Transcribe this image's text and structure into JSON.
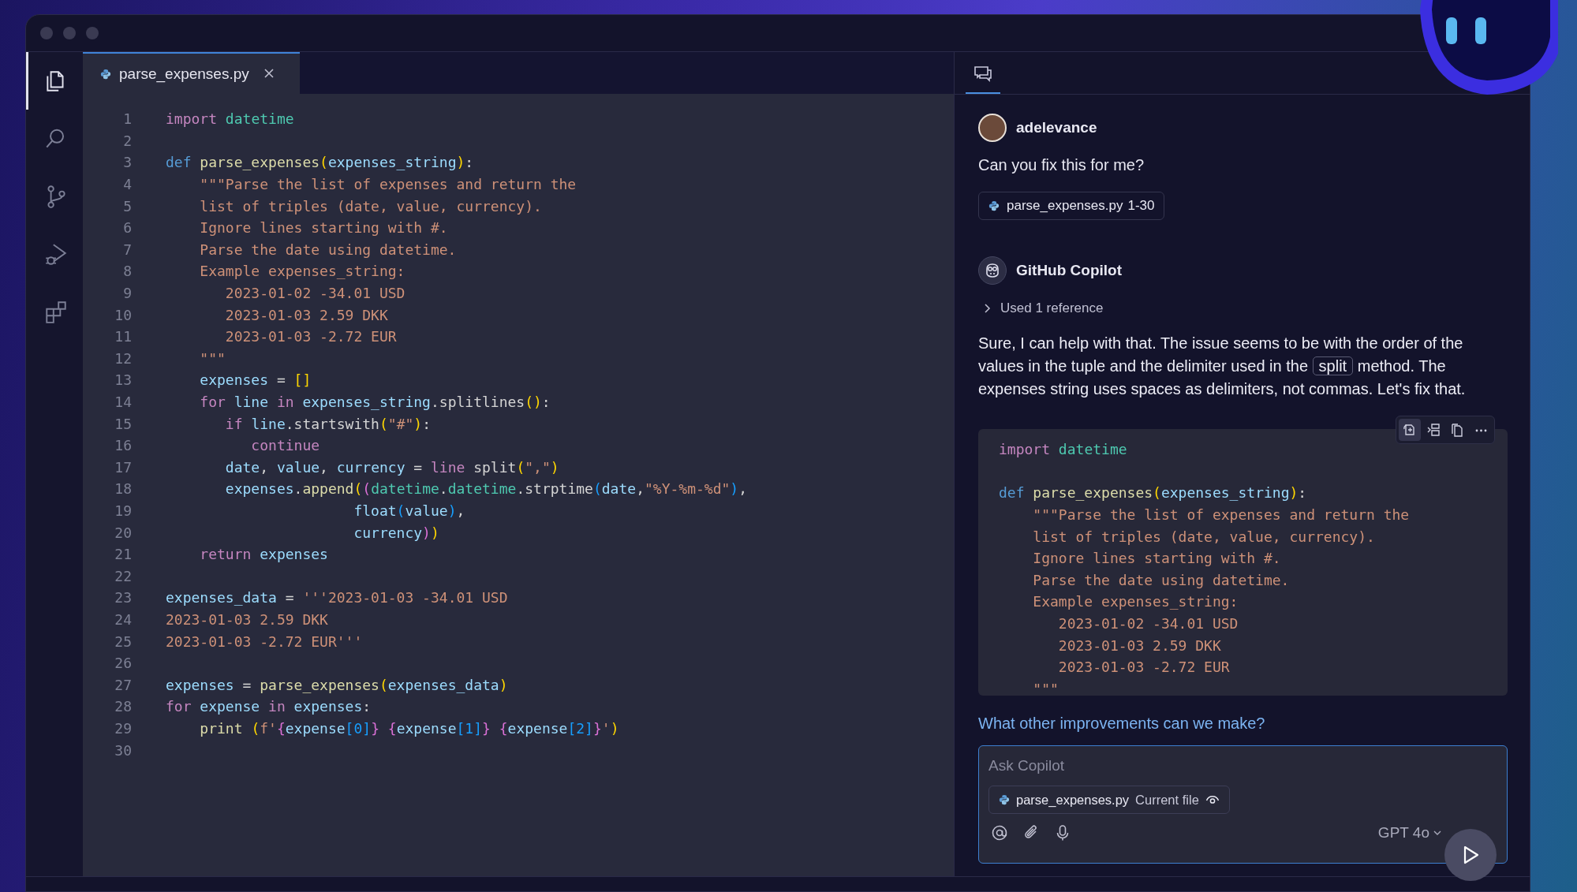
{
  "activity_bar": {
    "items": [
      {
        "kind": "files",
        "selected": true
      },
      {
        "kind": "search",
        "selected": false
      },
      {
        "kind": "source-control",
        "selected": false
      },
      {
        "kind": "run-debug",
        "selected": false
      },
      {
        "kind": "extensions",
        "selected": false
      }
    ]
  },
  "editor": {
    "tab": {
      "label": "parse_expenses.py",
      "selected": true
    },
    "lines": [
      {
        "number": "1",
        "tokens": [
          {
            "text": "import",
            "kind": "kw"
          },
          {
            "text": " datetime",
            "kind": "mod"
          }
        ]
      },
      {
        "number": "2"
      },
      {
        "number": "3",
        "tokens": [
          {
            "text": "def",
            "kind": "def"
          },
          {
            "text": " parse_expenses",
            "kind": "fn"
          },
          {
            "text": "(",
            "kind": "br1"
          },
          {
            "text": "expenses_string",
            "kind": "var"
          },
          {
            "text": ")",
            "kind": "br1"
          },
          {
            "text": ":",
            "kind": "op"
          }
        ]
      },
      {
        "number": "4",
        "tokens": [
          {
            "text": "    \"\"\"Parse the list of expenses and return the",
            "kind": "str"
          }
        ]
      },
      {
        "number": "5",
        "tokens": [
          {
            "text": "    list of triples (date, value, currency).",
            "kind": "str"
          }
        ]
      },
      {
        "number": "6",
        "tokens": [
          {
            "text": "    Ignore lines starting with #.",
            "kind": "str"
          }
        ]
      },
      {
        "number": "7",
        "tokens": [
          {
            "text": "    Parse the date using datetime.",
            "kind": "str"
          }
        ]
      },
      {
        "number": "8",
        "tokens": [
          {
            "text": "    Example expenses_string:",
            "kind": "str"
          }
        ]
      },
      {
        "number": "9",
        "tokens": [
          {
            "text": "       2023-01-02 -34.01 USD",
            "kind": "str"
          }
        ]
      },
      {
        "number": "10",
        "tokens": [
          {
            "text": "       2023-01-03 2.59 DKK",
            "kind": "str"
          }
        ]
      },
      {
        "number": "11",
        "tokens": [
          {
            "text": "       2023-01-03 -2.72 EUR",
            "kind": "str"
          }
        ]
      },
      {
        "number": "12",
        "tokens": [
          {
            "text": "    \"\"\"",
            "kind": "str"
          }
        ]
      },
      {
        "number": "13",
        "tokens": [
          {
            "text": "    expenses",
            "kind": "var"
          },
          {
            "text": " = ",
            "kind": "op"
          },
          {
            "text": "[]",
            "kind": "br1"
          }
        ]
      },
      {
        "number": "14",
        "tokens": [
          {
            "text": "    for",
            "kind": "kw"
          },
          {
            "text": " line",
            "kind": "var"
          },
          {
            "text": " in",
            "kind": "kw"
          },
          {
            "text": " expenses_string",
            "kind": "var"
          },
          {
            "text": ".splitlines",
            "kind": "op"
          },
          {
            "text": "()",
            "kind": "br1"
          },
          {
            "text": ":",
            "kind": "op"
          }
        ]
      },
      {
        "number": "15",
        "tokens": [
          {
            "text": "       if",
            "kind": "kw"
          },
          {
            "text": " line",
            "kind": "var"
          },
          {
            "text": ".startswith",
            "kind": "op"
          },
          {
            "text": "(",
            "kind": "br1"
          },
          {
            "text": "\"#\"",
            "kind": "str"
          },
          {
            "text": ")",
            "kind": "br1"
          },
          {
            "text": ":",
            "kind": "op"
          }
        ]
      },
      {
        "number": "16",
        "tokens": [
          {
            "text": "          continue",
            "kind": "kw"
          }
        ]
      },
      {
        "number": "17",
        "tokens": [
          {
            "text": "       date",
            "kind": "var"
          },
          {
            "text": ", ",
            "kind": "op"
          },
          {
            "text": "value",
            "kind": "var"
          },
          {
            "text": ", ",
            "kind": "op"
          },
          {
            "text": "currency",
            "kind": "var"
          },
          {
            "text": " = ",
            "kind": "op"
          },
          {
            "text": "line",
            "kind": "kw"
          },
          {
            "text": " split",
            "kind": "op"
          },
          {
            "text": "(",
            "kind": "br1"
          },
          {
            "text": "\",\"",
            "kind": "str"
          },
          {
            "text": ")",
            "kind": "br1"
          }
        ]
      },
      {
        "number": "18",
        "tokens": [
          {
            "text": "       expenses",
            "kind": "var"
          },
          {
            "text": ".",
            "kind": "op"
          },
          {
            "text": "append",
            "kind": "fn"
          },
          {
            "text": "(",
            "kind": "br1"
          },
          {
            "text": "(",
            "kind": "br2"
          },
          {
            "text": "datetime",
            "kind": "mod"
          },
          {
            "text": ".",
            "kind": "op"
          },
          {
            "text": "datetime",
            "kind": "mod"
          },
          {
            "text": ".strptime",
            "kind": "op"
          },
          {
            "text": "(",
            "kind": "br3"
          },
          {
            "text": "date",
            "kind": "var"
          },
          {
            "text": ",",
            "kind": "op"
          },
          {
            "text": "\"%Y-%m-%d\"",
            "kind": "str"
          },
          {
            "text": ")",
            "kind": "br3"
          },
          {
            "text": ",",
            "kind": "op"
          }
        ]
      },
      {
        "number": "19",
        "tokens": [
          {
            "text": "                      float",
            "kind": "var"
          },
          {
            "text": "(",
            "kind": "br3"
          },
          {
            "text": "value",
            "kind": "var"
          },
          {
            "text": ")",
            "kind": "br3"
          },
          {
            "text": ",",
            "kind": "op"
          }
        ]
      },
      {
        "number": "20",
        "tokens": [
          {
            "text": "                      currency",
            "kind": "var"
          },
          {
            "text": ")",
            "kind": "br2"
          },
          {
            "text": ")",
            "kind": "br1"
          }
        ]
      },
      {
        "number": "21",
        "tokens": [
          {
            "text": "    return",
            "kind": "kw"
          },
          {
            "text": " expenses",
            "kind": "var"
          }
        ]
      },
      {
        "number": "22"
      },
      {
        "number": "23",
        "tokens": [
          {
            "text": "expenses_data",
            "kind": "var"
          },
          {
            "text": " = ",
            "kind": "op"
          },
          {
            "text": "'''2023-01-03 -34.01 USD",
            "kind": "str"
          }
        ]
      },
      {
        "number": "24",
        "tokens": [
          {
            "text": "2023-01-03 2.59 DKK",
            "kind": "str"
          }
        ]
      },
      {
        "number": "25",
        "tokens": [
          {
            "text": "2023-01-03 -2.72 EUR'''",
            "kind": "str"
          }
        ]
      },
      {
        "number": "26"
      },
      {
        "number": "27",
        "tokens": [
          {
            "text": "expenses",
            "kind": "var"
          },
          {
            "text": " = ",
            "kind": "op"
          },
          {
            "text": "parse_expenses",
            "kind": "fn"
          },
          {
            "text": "(",
            "kind": "br1"
          },
          {
            "text": "expenses_data",
            "kind": "var"
          },
          {
            "text": ")",
            "kind": "br1"
          }
        ]
      },
      {
        "number": "28",
        "tokens": [
          {
            "text": "for",
            "kind": "kw"
          },
          {
            "text": " expense",
            "kind": "var"
          },
          {
            "text": " in",
            "kind": "kw"
          },
          {
            "text": " expenses",
            "kind": "var"
          },
          {
            "text": ":",
            "kind": "op"
          }
        ]
      },
      {
        "number": "29",
        "tokens": [
          {
            "text": "    print ",
            "kind": "fn"
          },
          {
            "text": "(",
            "kind": "br1"
          },
          {
            "text": "f'",
            "kind": "str"
          },
          {
            "text": "{",
            "kind": "br2"
          },
          {
            "text": "expense",
            "kind": "var"
          },
          {
            "text": "[0]",
            "kind": "br3"
          },
          {
            "text": "} ",
            "kind": "br2"
          },
          {
            "text": "{",
            "kind": "br2"
          },
          {
            "text": "expense",
            "kind": "var"
          },
          {
            "text": "[1]",
            "kind": "br3"
          },
          {
            "text": "} ",
            "kind": "br2"
          },
          {
            "text": "{",
            "kind": "br2"
          },
          {
            "text": "expense",
            "kind": "var"
          },
          {
            "text": "[2]",
            "kind": "br3"
          },
          {
            "text": "}",
            "kind": "br2"
          },
          {
            "text": "'",
            "kind": "str"
          },
          {
            "text": ")",
            "kind": "br1"
          }
        ]
      },
      {
        "number": "30"
      }
    ]
  },
  "chat": {
    "tab": {
      "selected": true
    },
    "messages": [
      {
        "kind": "user",
        "author": "adelevance",
        "text": "Can you fix this for me?",
        "reference": {
          "file": "parse_expenses.py",
          "range": "1-30"
        }
      },
      {
        "kind": "assistant",
        "author": "GitHub Copilot",
        "references_toggle": {
          "label": "Used 1 reference",
          "expanded": false
        },
        "parts": [
          {
            "text": "Sure, I can help with that. The issue seems to be with the order of the values in the tuple and the delimiter used in the ",
            "kind": "plain"
          },
          {
            "text": "split",
            "kind": "code"
          },
          {
            "text": " method. The expenses string uses spaces as delimiters, not commas. Let's fix that.",
            "kind": "plain"
          }
        ],
        "code_block": {
          "groups": [
            {
              "lines": [
                {
                  "tokens": [
                    {
                      "text": "import",
                      "kind": "kw"
                    },
                    {
                      "text": " datetime",
                      "kind": "mod"
                    }
                  ]
                }
              ]
            },
            {
              "lines": [
                {
                  "tokens": [
                    {
                      "text": "def",
                      "kind": "def"
                    },
                    {
                      "text": " parse_expenses",
                      "kind": "fn"
                    },
                    {
                      "text": "(",
                      "kind": "br1"
                    },
                    {
                      "text": "expenses_string",
                      "kind": "var"
                    },
                    {
                      "text": ")",
                      "kind": "br1"
                    },
                    {
                      "text": ":",
                      "kind": "op"
                    }
                  ]
                },
                {
                  "tokens": [
                    {
                      "text": "    \"\"\"Parse the list of expenses and return the",
                      "kind": "str"
                    }
                  ]
                },
                {
                  "tokens": [
                    {
                      "text": "    list of triples (date, value, currency).",
                      "kind": "str"
                    }
                  ]
                },
                {
                  "tokens": [
                    {
                      "text": "    Ignore lines starting with #.",
                      "kind": "str"
                    }
                  ]
                },
                {
                  "tokens": [
                    {
                      "text": "    Parse the date using datetime.",
                      "kind": "str"
                    }
                  ]
                },
                {
                  "tokens": [
                    {
                      "text": "    Example expenses_string:",
                      "kind": "str"
                    }
                  ]
                },
                {
                  "tokens": [
                    {
                      "text": "       2023-01-02 -34.01 USD",
                      "kind": "str"
                    }
                  ]
                },
                {
                  "tokens": [
                    {
                      "text": "       2023-01-03 2.59 DKK",
                      "kind": "str"
                    }
                  ]
                },
                {
                  "tokens": [
                    {
                      "text": "       2023-01-03 -2.72 EUR",
                      "kind": "str"
                    }
                  ]
                },
                {
                  "tokens": [
                    {
                      "text": "    \"\"\"",
                      "kind": "str"
                    }
                  ]
                }
              ]
            }
          ]
        }
      }
    ],
    "followup": "What other improvements can we make?",
    "input": {
      "placeholder": "Ask Copilot",
      "context": {
        "file": "parse_expenses.py",
        "label": "Current file"
      },
      "model": "GPT 4o"
    }
  }
}
